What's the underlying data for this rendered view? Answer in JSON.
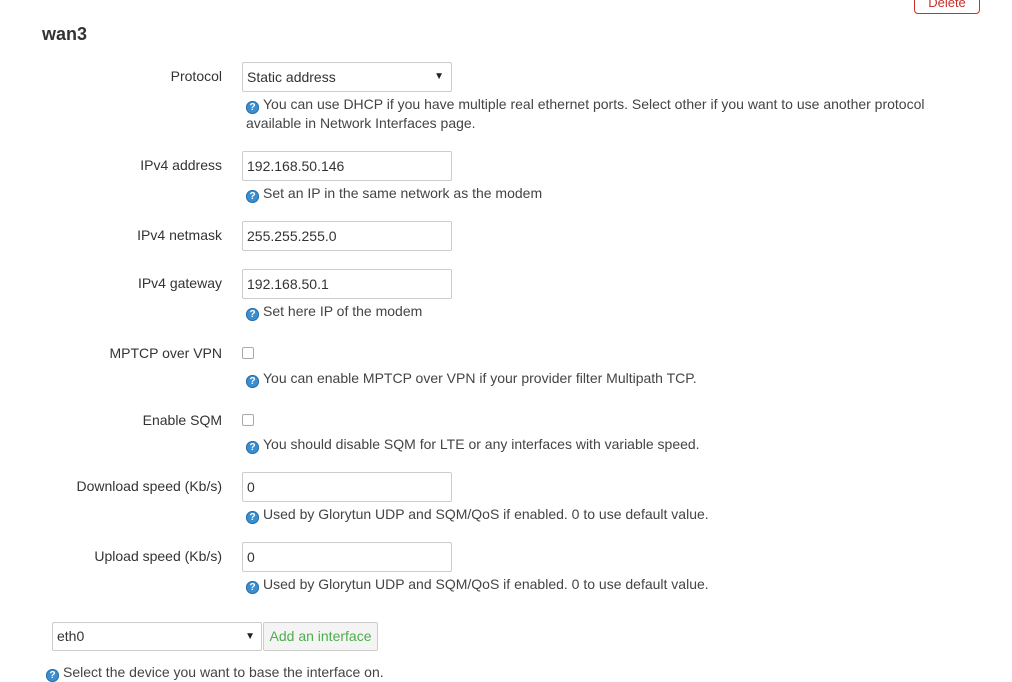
{
  "header": {
    "delete_label": "Delete"
  },
  "section": {
    "title": "wan3"
  },
  "form": {
    "protocol": {
      "label": "Protocol",
      "value": "Static address",
      "help": "You can use DHCP if you have multiple real ethernet ports. Select other if you want to use another protocol available in Network Interfaces page."
    },
    "ipv4_address": {
      "label": "IPv4 address",
      "value": "192.168.50.146",
      "help": "Set an IP in the same network as the modem"
    },
    "ipv4_netmask": {
      "label": "IPv4 netmask",
      "value": "255.255.255.0"
    },
    "ipv4_gateway": {
      "label": "IPv4 gateway",
      "value": "192.168.50.1",
      "help": "Set here IP of the modem"
    },
    "mptcp_vpn": {
      "label": "MPTCP over VPN",
      "checked": false,
      "help": "You can enable MPTCP over VPN if your provider filter Multipath TCP."
    },
    "sqm": {
      "label": "Enable SQM",
      "checked": false,
      "help": "You should disable SQM for LTE or any interfaces with variable speed."
    },
    "download_speed": {
      "label": "Download speed (Kb/s)",
      "value": "0",
      "help": "Used by Glorytun UDP and SQM/QoS if enabled. 0 to use default value."
    },
    "upload_speed": {
      "label": "Upload speed (Kb/s)",
      "value": "0",
      "help": "Used by Glorytun UDP and SQM/QoS if enabled. 0 to use default value."
    }
  },
  "device": {
    "value": "eth0",
    "add_label": "Add an interface",
    "help": "Select the device you want to base the interface on."
  },
  "colors": {
    "danger": "#c9302c",
    "success": "#4cae4c",
    "info": "#3a8fd0"
  }
}
